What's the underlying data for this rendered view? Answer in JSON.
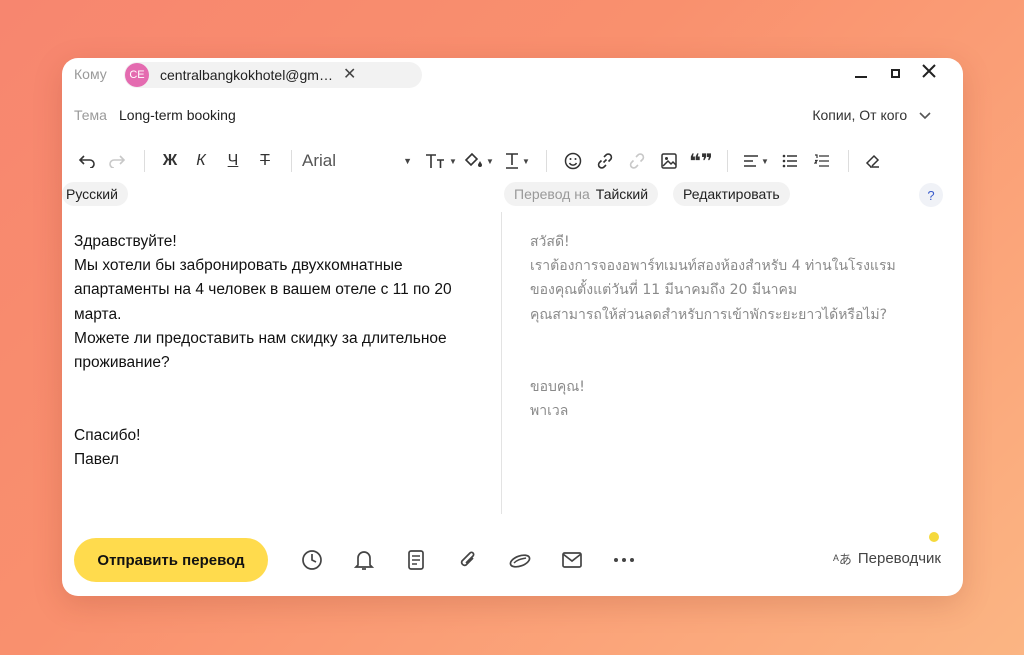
{
  "header": {
    "to_label": "Кому",
    "recipient": {
      "initials": "CE",
      "address": "centralbangkokhotel@gm…",
      "avatar_color": "#e46bb0"
    },
    "remove_glyph": "✕"
  },
  "subject": {
    "label": "Тема",
    "value": "Long-term booking",
    "copies_label": "Копии, От кого"
  },
  "toolbar": {
    "font_name": "Arial",
    "bold": "Ж",
    "italic": "К",
    "underline": "Ч",
    "strike": "Т"
  },
  "translation": {
    "source_lang": "Русский",
    "target_prefix": "Перевод на",
    "target_lang": "Тайский",
    "edit_label": "Редактировать",
    "help_label": "?"
  },
  "message": {
    "original": [
      "Здравствуйте!",
      "Мы хотели бы забронировать двухкомнатные",
      "апартаменты на 4 человек в вашем отеле с 11 по 20",
      "марта.",
      "Можете ли предоставить нам скидку за длительное",
      "проживание?",
      "",
      "",
      "Спасибо!",
      "Павел"
    ],
    "translated": [
      "สวัสดี!",
      "เราต้องการจองอพาร์ทเมนท์สองห้องสำหรับ 4 ท่านในโรงแรม",
      "ของคุณตั้งแต่วันที่ 11 มีนาคมถึง 20 มีนาคม",
      "คุณสามารถให้ส่วนลดสำหรับการเข้าพักระยะยาวได้หรือไม่?",
      "",
      "",
      "ขอบคุณ!",
      "พาเวล"
    ]
  },
  "footer": {
    "send_label": "Отправить перевод",
    "translator_label": "Переводчик",
    "accent": "#ffdb4d"
  }
}
